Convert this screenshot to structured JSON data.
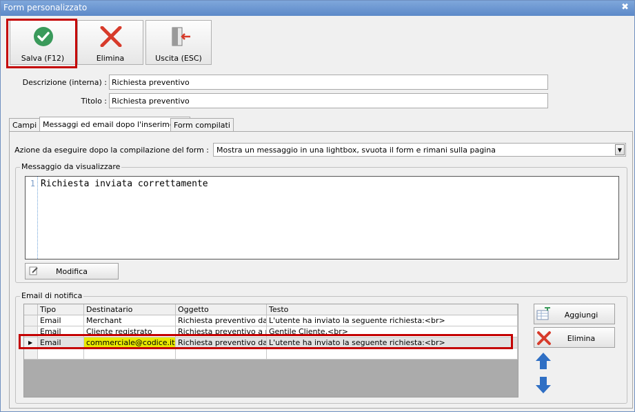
{
  "window": {
    "title": "Form personalizzato",
    "close_glyph": "✖"
  },
  "toolbar": {
    "save": {
      "label": "Salva (F12)",
      "icon": "check-circle-icon",
      "color": "#3a9a5b"
    },
    "delete": {
      "label": "Elimina",
      "icon": "x-icon",
      "color": "#d73b2b"
    },
    "exit": {
      "label": "Uscita (ESC)",
      "icon": "exit-door-icon"
    }
  },
  "form": {
    "descrizione_label": "Descrizione (interna) :",
    "descrizione_value": "Richiesta preventivo",
    "titolo_label": "Titolo :",
    "titolo_value": "Richiesta preventivo"
  },
  "tabs": [
    {
      "label": "Campi",
      "active": false
    },
    {
      "label": "Messaggi ed email dopo l'inserimento",
      "active": true
    },
    {
      "label": "Form compilati",
      "active": false
    }
  ],
  "action": {
    "label": "Azione da eseguire dopo la compilazione del form :",
    "value": "Mostra un messaggio in una lightbox, svuota il form e rimani sulla pagina"
  },
  "message": {
    "group_title": "Messaggio da visualizzare",
    "line_number": "1",
    "text": "Richiesta inviata correttamente",
    "edit_button": "Modifica"
  },
  "notifications": {
    "group_title": "Email di notifica",
    "columns": [
      "Tipo",
      "Destinatario",
      "Oggetto",
      "Testo"
    ],
    "rows": [
      {
        "tipo": "Email",
        "destinatario": "Merchant",
        "oggetto": "Richiesta preventivo da...",
        "testo": "L'utente ha inviato la seguente richiesta:<br>",
        "selected": false
      },
      {
        "tipo": "Email",
        "destinatario": "Cliente registrato",
        "oggetto": "Richiesta preventivo a r...",
        "testo": "Gentile Cliente,<br>",
        "selected": false
      },
      {
        "tipo": "Email",
        "destinatario": "commerciale@codice.it",
        "oggetto": "Richiesta preventivo da...",
        "testo": "L'utente ha inviato la seguente richiesta:<br>",
        "selected": true
      }
    ],
    "add_button": "Aggiungi",
    "delete_button": "Elimina",
    "highlight_color": "#e8e800"
  },
  "colors": {
    "annotation_red": "#c40000",
    "move_arrow": "#2f6fc4"
  }
}
